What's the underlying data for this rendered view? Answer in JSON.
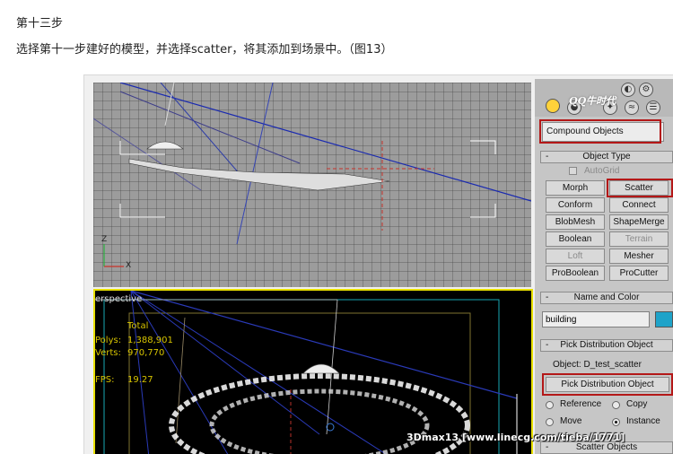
{
  "article": {
    "step_title": "第十三步",
    "step_description": "选择第十一步建好的模型，并选择scatter，将其添加到场景中。（图13）"
  },
  "viewport_perspective": {
    "label": "erspective",
    "stats_total_label": "Total",
    "stats_polys_label": "Polys:",
    "stats_polys_value": "1,388,901",
    "stats_verts_label": "Verts:",
    "stats_verts_value": "970,770",
    "fps_label": "FPS:",
    "fps_value": "19.27"
  },
  "viewport_top": {
    "axis_z": "Z",
    "axis_x": "X"
  },
  "command_panel": {
    "logo_text": "QQ牛时代",
    "dropdown_value": "Compound Objects",
    "object_type": {
      "rollout_title": "Object Type",
      "minus": "-",
      "autogrid_label": "AutoGrid",
      "buttons": [
        "Morph",
        "Scatter",
        "Conform",
        "Connect",
        "BlobMesh",
        "ShapeMerge",
        "Boolean",
        "Terrain",
        "Loft",
        "Mesher",
        "ProBoolean",
        "ProCutter"
      ],
      "disabled": [
        "Terrain",
        "Loft"
      ]
    },
    "name_and_color": {
      "rollout_title": "Name and Color",
      "minus": "-",
      "name_value": "building",
      "color": "#1fa3c9"
    },
    "pick_distribution": {
      "rollout_title": "Pick Distribution Object",
      "minus": "-",
      "object_label": "Object: D_test_scatter",
      "button_label": "Pick Distribution Object",
      "radio_reference": "Reference",
      "radio_copy": "Copy",
      "radio_move": "Move",
      "radio_instance": "Instance",
      "selected": "Instance"
    },
    "scatter_objects": {
      "rollout_title": "Scatter Objects",
      "minus": "-"
    },
    "icons": [
      "sphere-icon",
      "shapes-icon",
      "lights-icon",
      "camera-icon",
      "helpers-icon",
      "spacewarps-icon",
      "systems-icon"
    ]
  },
  "watermark": "3Dmax13 [www.linecg.com/tieba/1771]",
  "colors": {
    "highlight_red": "#b41818",
    "viewport_active_border": "#e8e000",
    "stats_text": "#d7c400"
  }
}
